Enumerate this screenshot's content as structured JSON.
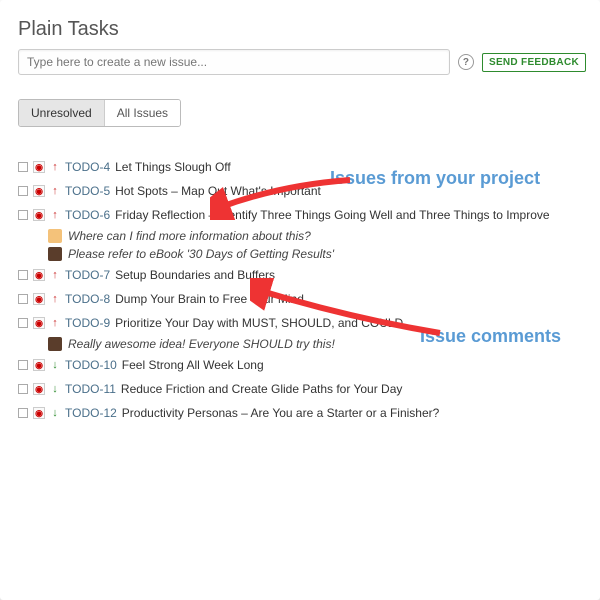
{
  "header": {
    "title": "Plain Tasks",
    "new_issue_placeholder": "Type here to create a new issue...",
    "feedback_label": "SEND FEEDBACK"
  },
  "tabs": {
    "unresolved": "Unresolved",
    "all": "All Issues",
    "selected": "unresolved"
  },
  "issues": [
    {
      "key": "TODO-4",
      "title": "Let Things Slough Off",
      "priority": "up",
      "comments": []
    },
    {
      "key": "TODO-5",
      "title": "Hot Spots – Map Out What's Important",
      "priority": "up",
      "comments": []
    },
    {
      "key": "TODO-6",
      "title": "Friday Reflection – Identify Three Things Going Well and Three Things to Improve",
      "priority": "up",
      "comments": [
        {
          "avatar": "av1",
          "text": "Where can I find more information about this?"
        },
        {
          "avatar": "av2",
          "text": "Please refer to eBook '30 Days of Getting Results'"
        }
      ]
    },
    {
      "key": "TODO-7",
      "title": "Setup Boundaries and Buffers",
      "priority": "up",
      "comments": []
    },
    {
      "key": "TODO-8",
      "title": "Dump Your Brain to Free Your Mind",
      "priority": "up",
      "comments": []
    },
    {
      "key": "TODO-9",
      "title": "Prioritize Your Day with MUST, SHOULD, and COULD",
      "priority": "up",
      "comments": [
        {
          "avatar": "av2",
          "text": "Really awesome idea! Everyone SHOULD try this!"
        }
      ]
    },
    {
      "key": "TODO-10",
      "title": "Feel Strong All Week Long",
      "priority": "down",
      "comments": []
    },
    {
      "key": "TODO-11",
      "title": "Reduce Friction and Create Glide Paths for Your Day",
      "priority": "down",
      "comments": []
    },
    {
      "key": "TODO-12",
      "title": "Productivity Personas – Are You are a Starter or a Finisher?",
      "priority": "down",
      "comments": []
    }
  ],
  "annotations": {
    "issues_label": "Issues from your project",
    "comments_label": "Issue comments"
  }
}
